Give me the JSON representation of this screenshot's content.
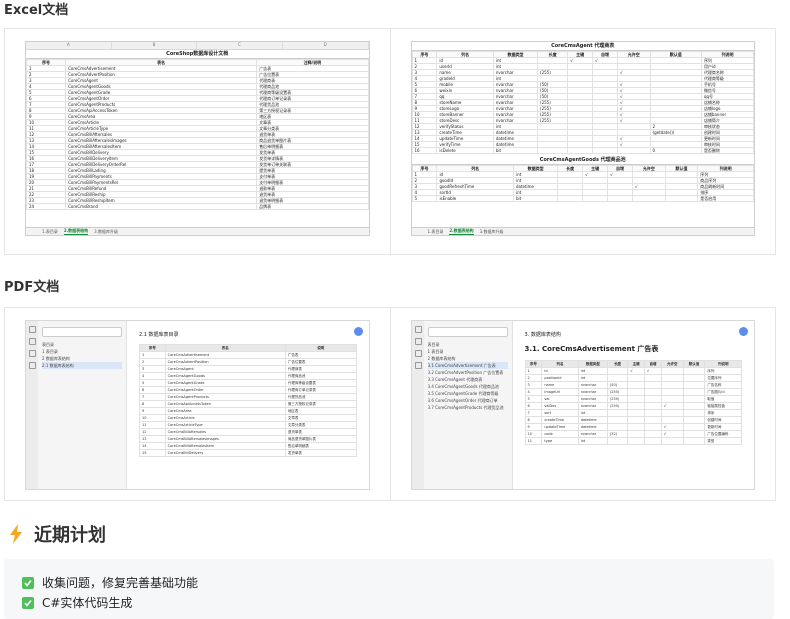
{
  "sections": {
    "excel": "Excel文档",
    "pdf": "PDF文档",
    "plan": "近期计划"
  },
  "excel_left": {
    "col_headers": [
      "A",
      "B",
      "C",
      "D"
    ],
    "title": "CoreShop数据库设计文档",
    "header": [
      "序号",
      "表名",
      "注释/说明"
    ],
    "rows": [
      [
        "1",
        "CoreCmsAdvertisement",
        "广告表"
      ],
      [
        "2",
        "CoreCmsAdvertPosition",
        "广告位置表"
      ],
      [
        "3",
        "CoreCmsAgent",
        "代理商表"
      ],
      [
        "4",
        "CoreCmsAgentGoods",
        "代理商品池"
      ],
      [
        "5",
        "CoreCmsAgentGrade",
        "代理商等级设置表"
      ],
      [
        "6",
        "CoreCmsAgentOrder",
        "代理商订单记录表"
      ],
      [
        "7",
        "CoreCmsAgentProducts",
        "代理货品池"
      ],
      [
        "8",
        "CoreCmsApiAccessToken",
        "第三方授权记录表"
      ],
      [
        "9",
        "CoreCmsArea",
        "地区表"
      ],
      [
        "10",
        "CoreCmsArticle",
        "文章表"
      ],
      [
        "11",
        "CoreCmsArticleType",
        "文章分类表"
      ],
      [
        "12",
        "CoreCmsBillAftersales",
        "退货单表"
      ],
      [
        "13",
        "CoreCmsBillAftersalesImages",
        "商品退货单图片表"
      ],
      [
        "14",
        "CoreCmsBillAftersalesItem",
        "售后单明细表"
      ],
      [
        "15",
        "CoreCmsBillDelivery",
        "发货单表"
      ],
      [
        "16",
        "CoreCmsBillDeliveryItem",
        "发货单详情表"
      ],
      [
        "17",
        "CoreCmsBillDeliveryOrderRel",
        "发货单订单关联表"
      ],
      [
        "18",
        "CoreCmsBillLading",
        "提货单表"
      ],
      [
        "19",
        "CoreCmsBillPayments",
        "支付单表"
      ],
      [
        "20",
        "CoreCmsBillPaymentsRel",
        "支付单明细表"
      ],
      [
        "21",
        "CoreCmsBillRefund",
        "退款单表"
      ],
      [
        "22",
        "CoreCmsBillReship",
        "退货单表"
      ],
      [
        "23",
        "CoreCmsBillReshipItem",
        "退货单明细表"
      ],
      [
        "24",
        "CoreCmsBrand",
        "品牌表"
      ]
    ],
    "tabs": [
      "1.表目录",
      "2.数据表结构",
      "3.数据库升级"
    ],
    "active_tab": 1
  },
  "excel_right": {
    "title1": "CoreCmsAgent 代理商表",
    "title2": "CoreCmsAgentGoods 代理商品池",
    "header": [
      "序号",
      "列名",
      "数据类型",
      "长度",
      "主键",
      "自增",
      "允许空",
      "默认值",
      "列说明"
    ],
    "rows1": [
      [
        "1",
        "id",
        "int",
        "",
        "√",
        "√",
        "",
        "",
        "序列"
      ],
      [
        "2",
        "userId",
        "int",
        "",
        "",
        "",
        "",
        "",
        "用户id"
      ],
      [
        "3",
        "name",
        "nvarchar",
        "(255)",
        "",
        "",
        "√",
        "",
        "代理商名称"
      ],
      [
        "4",
        "gradeId",
        "int",
        "",
        "",
        "",
        "",
        "",
        "代理商等级"
      ],
      [
        "5",
        "mobile",
        "nvarchar",
        "(50)",
        "",
        "",
        "√",
        "",
        "手机号"
      ],
      [
        "6",
        "weixin",
        "nvarchar",
        "(50)",
        "",
        "",
        "√",
        "",
        "微信号"
      ],
      [
        "7",
        "qq",
        "nvarchar",
        "(50)",
        "",
        "",
        "√",
        "",
        "qq号"
      ],
      [
        "8",
        "storeName",
        "nvarchar",
        "(255)",
        "",
        "",
        "√",
        "",
        "店铺名称"
      ],
      [
        "9",
        "storeLogo",
        "nvarchar",
        "(255)",
        "",
        "",
        "√",
        "",
        "店铺logo"
      ],
      [
        "10",
        "storeBanner",
        "nvarchar",
        "(255)",
        "",
        "",
        "√",
        "",
        "店铺banner"
      ],
      [
        "11",
        "storeDesc",
        "nvarchar",
        "(255)",
        "",
        "",
        "√",
        "",
        "店铺简介"
      ],
      [
        "12",
        "verifyStatus",
        "int",
        "",
        "",
        "",
        "",
        "2",
        "审核状态"
      ],
      [
        "13",
        "createTime",
        "datetime",
        "",
        "",
        "",
        "",
        "(getdate())",
        "创建时间"
      ],
      [
        "14",
        "updateTime",
        "datetime",
        "",
        "",
        "",
        "√",
        "",
        "更新时间"
      ],
      [
        "15",
        "verifyTime",
        "datetime",
        "",
        "",
        "",
        "√",
        "",
        "审核时间"
      ],
      [
        "16",
        "isDelete",
        "bit",
        "",
        "",
        "",
        "",
        "0",
        "是否删除"
      ]
    ],
    "rows2": [
      [
        "1",
        "id",
        "int",
        "",
        "√",
        "√",
        "",
        "",
        "序列"
      ],
      [
        "2",
        "goodId",
        "int",
        "",
        "",
        "",
        "",
        "",
        "商品序列"
      ],
      [
        "3",
        "goodRefreshTime",
        "datetime",
        "",
        "",
        "",
        "√",
        "",
        "商品刷新时间"
      ],
      [
        "4",
        "sortId",
        "int",
        "",
        "",
        "",
        "",
        "",
        "排序"
      ],
      [
        "5",
        "isEnable",
        "bit",
        "",
        "",
        "",
        "",
        "",
        "是否启用"
      ]
    ],
    "tabs": [
      "1.表目录",
      "2.数据表结构",
      "3.数据库升级"
    ],
    "active_tab": 1
  },
  "pdf_left": {
    "outline": [
      "表目录",
      "1 表目录",
      "2 数据库表结构",
      "2.1 数据库表结构"
    ],
    "page_title": "2.1 数据库表目录",
    "header": [
      "序号",
      "表名",
      "说明"
    ],
    "rows": [
      [
        "1",
        "CoreCmsAdvertisement",
        "广告表"
      ],
      [
        "2",
        "CoreCmsAdvertPosition",
        "广告位置表"
      ],
      [
        "3",
        "CoreCmsAgent",
        "代理商表"
      ],
      [
        "4",
        "CoreCmsAgentGoods",
        "代理商品池"
      ],
      [
        "5",
        "CoreCmsAgentGrade",
        "代理商等级设置表"
      ],
      [
        "6",
        "CoreCmsAgentOrder",
        "代理商订单记录表"
      ],
      [
        "7",
        "CoreCmsAgentProducts",
        "代理货品池"
      ],
      [
        "8",
        "CoreCmsApiAccessToken",
        "第三方授权记录表"
      ],
      [
        "9",
        "CoreCmsArea",
        "地区表"
      ],
      [
        "10",
        "CoreCmsArticle",
        "文章表"
      ],
      [
        "11",
        "CoreCmsArticleType",
        "文章分类表"
      ],
      [
        "12",
        "CoreCmsBillAftersales",
        "退货单表"
      ],
      [
        "13",
        "CoreCmsBillAftersalesImages",
        "商品退货单图片表"
      ],
      [
        "14",
        "CoreCmsBillAftersalesItem",
        "售后单明细表"
      ],
      [
        "15",
        "CoreCmsBillDelivery",
        "发货单表"
      ]
    ]
  },
  "pdf_right": {
    "outline": [
      "表目录",
      "1 表目录",
      "2 数据库表结构",
      "3.1 CoreCmsAdvertisement 广告表",
      "3.2 CoreCmsAdvertPosition 广告位置表",
      "3.3 CoreCmsAgent 代理商表",
      "3.4 CoreCmsAgentGoods 代理商品池",
      "3.5 CoreCmsAgentGrade 代理商等级",
      "3.6 CoreCmsAgentOrder 代理商订单",
      "3.7 CoreCmsAgentProducts 代理货品池"
    ],
    "page_title": "3. 数据库表结构",
    "section_title": "3.1. CoreCmsAdvertisement 广告表",
    "header": [
      "序号",
      "列名",
      "数据类型",
      "长度",
      "主键",
      "自增",
      "允许空",
      "默认值",
      "列说明"
    ],
    "rows": [
      [
        "1",
        "id",
        "int",
        "",
        "√",
        "√",
        "",
        "",
        "序列"
      ],
      [
        "2",
        "positionId",
        "int",
        "",
        "",
        "",
        "",
        "",
        "位置序列"
      ],
      [
        "3",
        "name",
        "nvarchar",
        "(50)",
        "",
        "",
        "",
        "",
        "广告名称"
      ],
      [
        "4",
        "imageUrl",
        "nvarchar",
        "(255)",
        "",
        "",
        "",
        "",
        "广告图片id"
      ],
      [
        "5",
        "val",
        "nvarchar",
        "(255)",
        "",
        "",
        "",
        "",
        "取值"
      ],
      [
        "6",
        "valDes",
        "nvarchar",
        "(255)",
        "",
        "",
        "√",
        "",
        "链接属性值"
      ],
      [
        "7",
        "sort",
        "int",
        "",
        "",
        "",
        "",
        "",
        "排序"
      ],
      [
        "8",
        "createTime",
        "datetime",
        "",
        "",
        "",
        "",
        "",
        "创建时间"
      ],
      [
        "9",
        "updateTime",
        "datetime",
        "",
        "",
        "",
        "√",
        "",
        "更新时间"
      ],
      [
        "10",
        "code",
        "nvarchar",
        "(32)",
        "",
        "",
        "√",
        "",
        "广告位置编码"
      ],
      [
        "11",
        "type",
        "int",
        "",
        "",
        "",
        "",
        "",
        "类型"
      ]
    ]
  },
  "plans": [
    {
      "text": "收集问题，修复完善基础功能",
      "done": true
    },
    {
      "text": "C#实体代码生成",
      "done": true
    }
  ],
  "colors": {
    "check": "#4fbf5a",
    "bolt": "#f5a623",
    "accent": "#1a8a3e"
  }
}
